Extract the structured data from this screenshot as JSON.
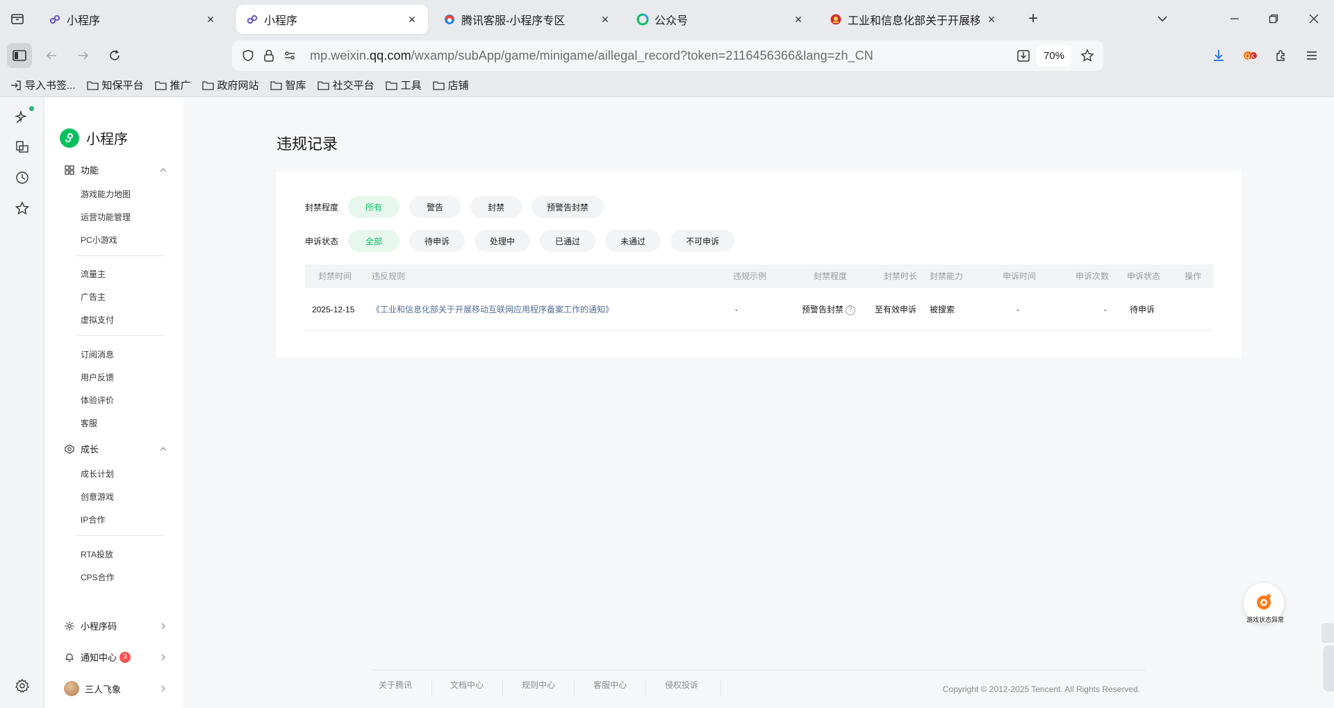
{
  "browser": {
    "tabs": [
      {
        "title": "小程序",
        "icon": "miniprogram-icon",
        "active": false
      },
      {
        "title": "小程序",
        "icon": "miniprogram-icon",
        "active": true
      },
      {
        "title": "腾讯客服-小程序专区",
        "icon": "tencent-service-icon",
        "active": false
      },
      {
        "title": "公众号",
        "icon": "wechat-official-icon",
        "active": false
      },
      {
        "title": "工业和信息化部关于开展移动互",
        "icon": "gov-emblem-icon",
        "active": false
      }
    ],
    "url": {
      "prefix": "mp.weixin.",
      "host": "qq.com",
      "path": "/wxamp/subApp/game/minigame/aillegal_record?token=2116456366&lang=zh_CN"
    },
    "zoom": "70%",
    "bookmarks": [
      "导入书签...",
      "知保平台",
      "推广",
      "政府网站",
      "智库",
      "社交平台",
      "工具",
      "店铺"
    ]
  },
  "sidebar": {
    "logo_text": "小程序",
    "groups": {
      "func": "功能",
      "growth": "成长",
      "code": "小程序码",
      "notify": "通知中心",
      "notify_count": "3",
      "user": "三人飞象"
    },
    "func_items": [
      "游戏能力地图",
      "运营功能管理",
      "PC小游戏",
      "流量主",
      "广告主",
      "虚拟支付",
      "订阅消息",
      "用户反馈",
      "体验评价",
      "客服"
    ],
    "growth_items": [
      "成长计划",
      "创意游戏",
      "IP合作",
      "RTA投放",
      "CPS合作"
    ]
  },
  "main": {
    "title": "违规记录",
    "filters": {
      "severity_label": "封禁程度",
      "severity_options": [
        "所有",
        "警告",
        "封禁",
        "预警告封禁"
      ],
      "severity_selected": 0,
      "appeal_label": "申诉状态",
      "appeal_options": [
        "全部",
        "待申诉",
        "处理中",
        "已通过",
        "未通过",
        "不可申诉"
      ],
      "appeal_selected": 0
    },
    "table": {
      "headers": [
        "封禁时间",
        "违反规则",
        "违规示例",
        "封禁程度",
        "封禁时长",
        "封禁能力",
        "申诉时间",
        "申诉次数",
        "申诉状态",
        "操作"
      ],
      "rows": [
        {
          "time": "2025-12-15",
          "rule": "《工业和信息化部关于开展移动互联网应用程序备案工作的通知》",
          "example": "-",
          "severity": "预警告封禁",
          "duration": "至有效申诉",
          "ability": "被搜索",
          "appeal_time": "-",
          "appeal_count": "-",
          "appeal_status": "待申诉"
        }
      ]
    }
  },
  "footer": {
    "links": [
      "关于腾讯",
      "文档中心",
      "规则中心",
      "客服中心",
      "侵权投诉"
    ],
    "copyright": "Copyright © 2012-2025 Tencent. All Rights Reserved."
  },
  "float": {
    "label": "游戏状态异常"
  },
  "colors": {
    "brand": "#07c160",
    "link": "#576b95",
    "badge": "#fa5151"
  }
}
